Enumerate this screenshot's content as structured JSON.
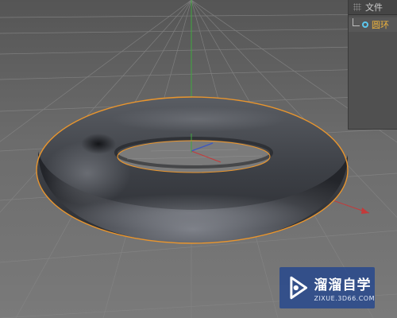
{
  "panel": {
    "menu_file": "文件",
    "objects": [
      {
        "name": "圆环",
        "icon": "torus-icon",
        "icon_color": "#5cc8ee",
        "label_color": "#f0b43c"
      }
    ]
  },
  "viewport": {
    "object_type": "torus",
    "selection_outline_color": "#e8952e",
    "axis_colors": {
      "x": "#c43a3a",
      "y": "#3fa83f",
      "z": "#3b55c4"
    }
  },
  "watermark": {
    "title": "溜溜自学",
    "url": "ZIXUE.3D66.COM"
  }
}
